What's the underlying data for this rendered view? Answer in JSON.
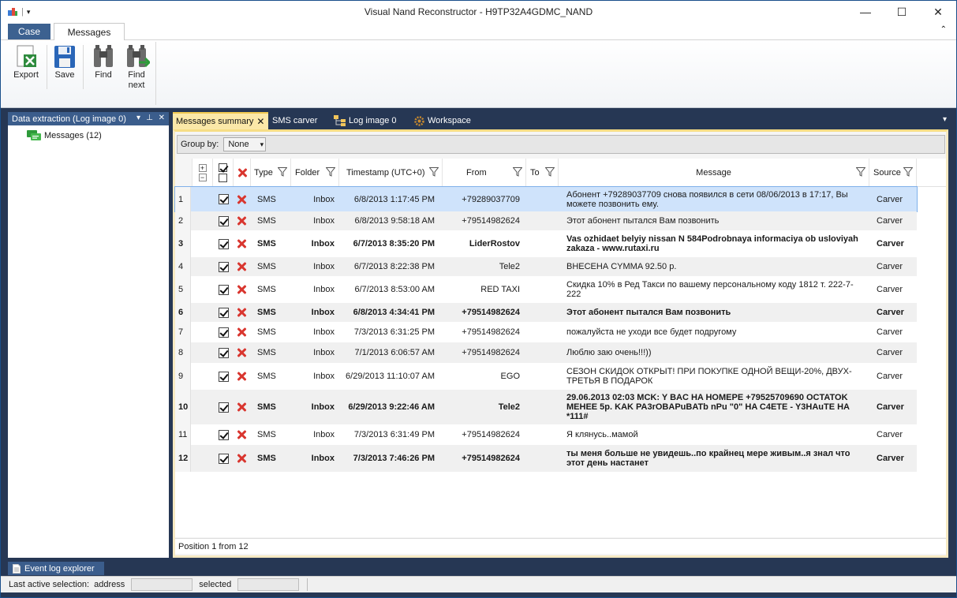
{
  "window": {
    "title": "Visual Nand Reconstructor - H9TP32A4GDMC_NAND",
    "minimize": "—",
    "maximize": "☐",
    "close": "✕"
  },
  "ribbon_tabs": [
    "Case",
    "Messages"
  ],
  "ribbon": {
    "export_label": "Export",
    "save_label": "Save",
    "find_label": "Find",
    "find_next_label": "Find next"
  },
  "left_panel": {
    "title": "Data extraction (Log image 0)",
    "tree_item": "Messages (12)"
  },
  "doc_tabs": [
    "Messages summary",
    "SMS carver",
    "Log image 0",
    "Workspace"
  ],
  "group_by": {
    "label": "Group by:",
    "value": "None"
  },
  "columns": [
    "Type",
    "Folder",
    "Timestamp (UTC+0)",
    "From",
    "To",
    "Message",
    "Source"
  ],
  "rows": [
    {
      "n": "1",
      "type": "SMS",
      "folder": "Inbox",
      "ts": "6/8/2013 1:17:45 PM",
      "from": "+79289037709",
      "to": "",
      "msg": "Абонент +79289037709 снова появился в сети 08/06/2013 в 17:17, Вы можете позвонить ему.",
      "src": "Carver",
      "bold": false
    },
    {
      "n": "2",
      "type": "SMS",
      "folder": "Inbox",
      "ts": "6/8/2013 9:58:18 AM",
      "from": "+79514982624",
      "to": "",
      "msg": "Этот абонент пытался Вам позвонить",
      "src": "Carver",
      "bold": false
    },
    {
      "n": "3",
      "type": "SMS",
      "folder": "Inbox",
      "ts": "6/7/2013 8:35:20 PM",
      "from": "LiderRostov",
      "to": "",
      "msg": "Vas ozhidaet belyiy nissan N 584Podrobnaya informaciya ob usloviyah zakaza - www.rutaxi.ru",
      "src": "Carver",
      "bold": true
    },
    {
      "n": "4",
      "type": "SMS",
      "folder": "Inbox",
      "ts": "6/7/2013 8:22:38 PM",
      "from": "Tele2",
      "to": "",
      "msg": "ВНЕСЕНА CYMMA 92.50 р.",
      "src": "Carver",
      "bold": false
    },
    {
      "n": "5",
      "type": "SMS",
      "folder": "Inbox",
      "ts": "6/7/2013 8:53:00 AM",
      "from": "RED TAXI",
      "to": "",
      "msg": "Скидка 10% в Ред Такси по вашему персональному коду 1812 т. 222-7-222",
      "src": "Carver",
      "bold": false
    },
    {
      "n": "6",
      "type": "SMS",
      "folder": "Inbox",
      "ts": "6/8/2013 4:34:41 PM",
      "from": "+79514982624",
      "to": "",
      "msg": "Этот абонент пытался Вам позвонить",
      "src": "Carver",
      "bold": true
    },
    {
      "n": "7",
      "type": "SMS",
      "folder": "Inbox",
      "ts": "7/3/2013 6:31:25 PM",
      "from": "+79514982624",
      "to": "",
      "msg": "пожалуйста не уходи все будет подругому",
      "src": "Carver",
      "bold": false
    },
    {
      "n": "8",
      "type": "SMS",
      "folder": "Inbox",
      "ts": "7/1/2013 6:06:57 AM",
      "from": "+79514982624",
      "to": "",
      "msg": "Люблю заю очень!!!))",
      "src": "Carver",
      "bold": false
    },
    {
      "n": "9",
      "type": "SMS",
      "folder": "Inbox",
      "ts": "6/29/2013 11:10:07 AM",
      "from": "EGO",
      "to": "",
      "msg": "СЕЗОН СКИДОК ОТКРЫТ! ПРИ ПОКУПКЕ ОДНОЙ ВЕЩИ-20%, ДВУХ-ТРЕТЬЯ В ПОДАРОК",
      "src": "Carver",
      "bold": false
    },
    {
      "n": "10",
      "type": "SMS",
      "folder": "Inbox",
      "ts": "6/29/2013 9:22:46 AM",
      "from": "Tele2",
      "to": "",
      "msg": "29.06.2013 02:03 MCK: Y BAC HA HOMEPE +79525709690 OCTATOK MEHEE 5p. KAK PA3rOBAPuBATb nPu \"0\" HA C4ETE - Y3HAuTE HA *111#",
      "src": "Carver",
      "bold": true
    },
    {
      "n": "11",
      "type": "SMS",
      "folder": "Inbox",
      "ts": "7/3/2013 6:31:49 PM",
      "from": "+79514982624",
      "to": "",
      "msg": "Я клянусь..мамой",
      "src": "Carver",
      "bold": false
    },
    {
      "n": "12",
      "type": "SMS",
      "folder": "Inbox",
      "ts": "7/3/2013 7:46:26 PM",
      "from": "+79514982624",
      "to": "",
      "msg": "ты меня больше не увидешь..по крайнец мере живым..я знал что этот день настанет",
      "src": "Carver",
      "bold": true
    }
  ],
  "grid_status": "Position 1 from 12",
  "event_tab": "Event log explorer",
  "status_bar": {
    "last_active": "Last active selection:",
    "address": "address",
    "selected": "selected"
  }
}
